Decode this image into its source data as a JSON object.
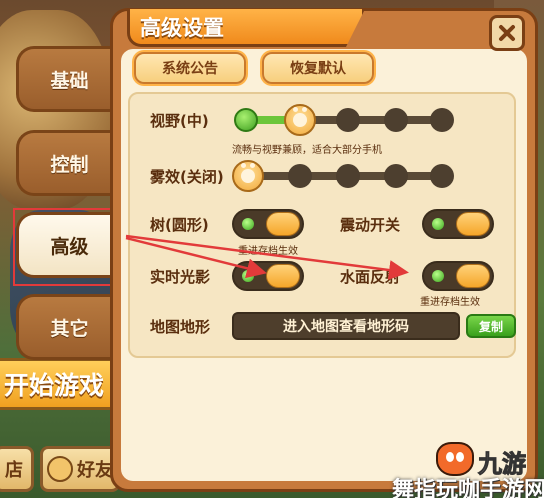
{
  "dialog": {
    "title": "高级设置",
    "buttons": {
      "notice": "系统公告",
      "reset": "恢复默认"
    }
  },
  "tabs": [
    {
      "label": "基础",
      "selected": false
    },
    {
      "label": "控制",
      "selected": false
    },
    {
      "label": "高级",
      "selected": true
    },
    {
      "label": "其它",
      "selected": false
    }
  ],
  "background": {
    "start_game": "开始游戏",
    "shop": "店",
    "friends": "好友"
  },
  "settings": {
    "view_distance": {
      "label": "视野(中)",
      "caption": "流畅与视野兼顾，适合大部分手机",
      "level": 2,
      "steps": 5
    },
    "fog": {
      "label": "雾效(关闭)",
      "level": 1,
      "steps": 5
    },
    "tree_shape": {
      "label": "树(圆形)",
      "caption": "重进存档生效",
      "on": true
    },
    "vibration": {
      "label": "震动开关",
      "on": true
    },
    "realtime_shadow": {
      "label": "实时光影",
      "on": true
    },
    "water_reflection": {
      "label": "水面反射",
      "caption": "重进存档生效",
      "on": true
    },
    "map_terrain": {
      "label": "地图地形",
      "field": "进入地图查看地形码",
      "copy": "复制"
    }
  },
  "watermark": {
    "brand": "九游",
    "text": "舞指玩咖手游网"
  },
  "colors": {
    "accent": "#f08a1c",
    "toggle_on": "#3aa51c",
    "annotation": "#e23a3a"
  }
}
